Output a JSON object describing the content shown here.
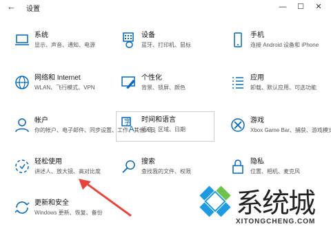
{
  "window": {
    "title": "设置",
    "back_glyph": "←",
    "minimize_glyph": "—",
    "maximize_glyph": "☐",
    "close_glyph": "✕"
  },
  "settings": [
    {
      "name": "系统",
      "desc": "显示、声音、通知、电源",
      "icon": "laptop-icon"
    },
    {
      "name": "设备",
      "desc": "蓝牙、打印机、鼠标",
      "icon": "keyboard-icon"
    },
    {
      "name": "手机",
      "desc": "连接 Android 设备和 iPhone",
      "icon": "phone-icon"
    },
    {
      "name": "网络和 Internet",
      "desc": "WLAN、飞行模式、VPN",
      "icon": "globe-icon"
    },
    {
      "name": "个性化",
      "desc": "背景、锁屏、颜色",
      "icon": "paint-icon"
    },
    {
      "name": "应用",
      "desc": "卸载、默认应用、可选功能",
      "icon": "apps-icon"
    },
    {
      "name": "帐户",
      "desc": "你的帐户、电子邮件、同步设置、工作、其他人员",
      "icon": "person-icon"
    },
    {
      "name": "时间和语言",
      "desc": "语音、区域、日期",
      "icon": "time-language-icon"
    },
    {
      "name": "游戏",
      "desc": "Xbox Game Bar、捕获、游戏模式",
      "icon": "xbox-icon"
    },
    {
      "name": "轻松使用",
      "desc": "讲述人、放大镜、高对比度",
      "icon": "ease-of-access-icon"
    },
    {
      "name": "搜索",
      "desc": "查找我的文件、权限",
      "icon": "search-icon"
    },
    {
      "name": "隐私",
      "desc": "位置、相机、麦克风",
      "icon": "lock-icon"
    },
    {
      "name": "更新和安全",
      "desc": "Windows 更新、恢复、备份",
      "icon": "update-icon"
    }
  ],
  "watermark": {
    "text": "系统城",
    "subtext": "XITONGCHENG.COM"
  },
  "colors": {
    "accent": "#0067c0",
    "arrow": "#e8443a"
  }
}
